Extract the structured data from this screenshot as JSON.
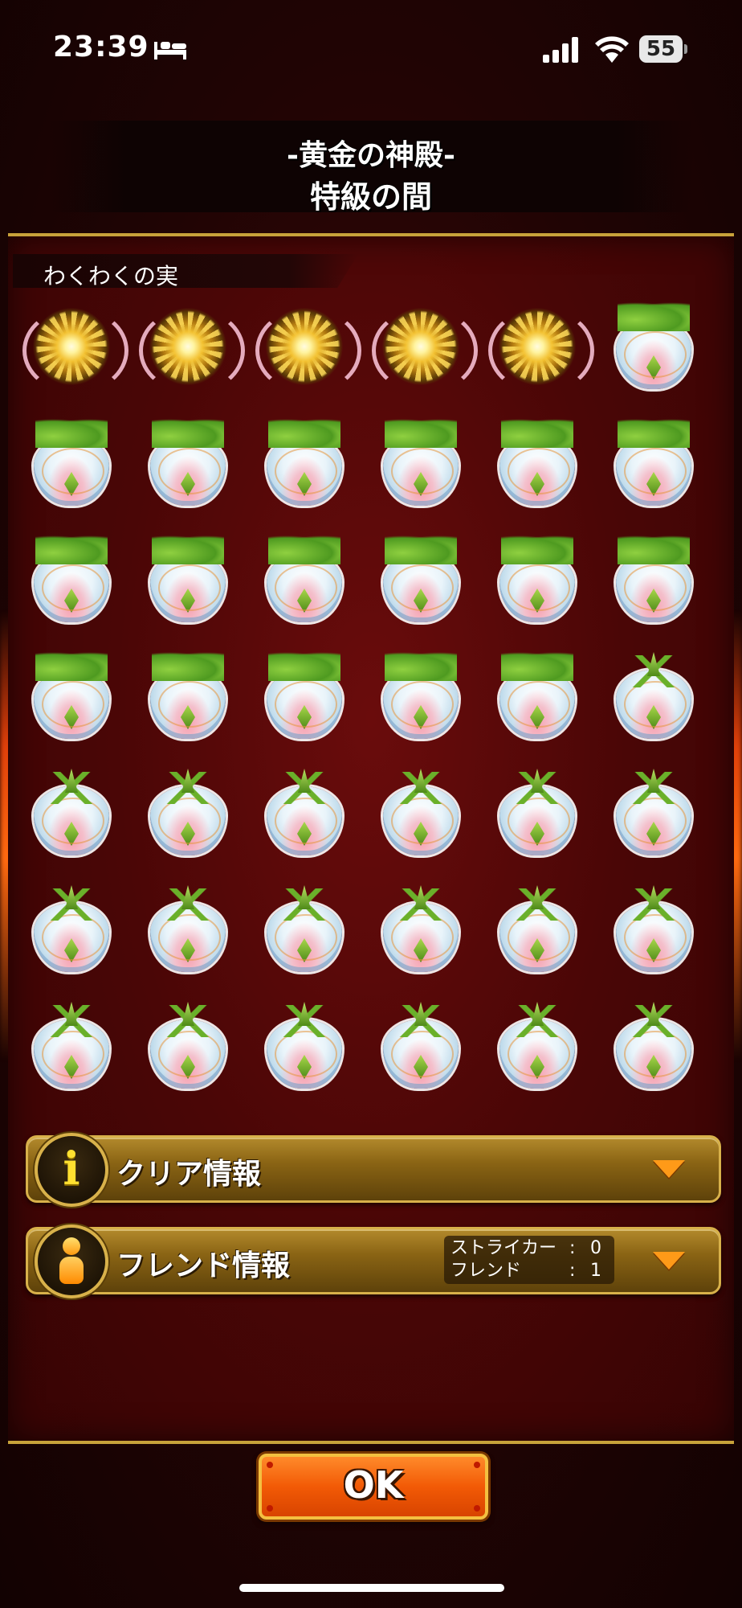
{
  "status_bar": {
    "time": "23:39",
    "battery": "55",
    "icons": [
      "bed-icon",
      "signal-icon",
      "wifi-icon",
      "battery-icon"
    ]
  },
  "header": {
    "title_line1": "-黄金の神殿-",
    "title_line2": "特級の間"
  },
  "rewards": {
    "section_label": "わくわくの実",
    "columns": 6,
    "rows": 7,
    "items": [
      "golden",
      "golden",
      "golden",
      "golden",
      "golden",
      "leaf",
      "leaf",
      "leaf",
      "leaf",
      "leaf",
      "leaf",
      "leaf",
      "leaf",
      "leaf",
      "leaf",
      "leaf",
      "leaf",
      "leaf",
      "leaf",
      "leaf",
      "leaf",
      "leaf",
      "leaf",
      "plain",
      "plain",
      "plain",
      "plain",
      "plain",
      "plain",
      "plain",
      "plain",
      "plain",
      "plain",
      "plain",
      "plain",
      "plain",
      "plain",
      "plain",
      "plain",
      "plain",
      "plain",
      "plain"
    ]
  },
  "clear_info": {
    "label": "クリア情報",
    "icon": "info-icon"
  },
  "friend_info": {
    "label": "フレンド情報",
    "icon": "friend-icon",
    "striker_label": "ストライカー",
    "striker_value": "0",
    "friend_label": "フレンド",
    "friend_value": "1",
    "colon": ":"
  },
  "ok_button": {
    "label": "OK"
  },
  "colors": {
    "accent_gold": "#d8b14a",
    "panel_red": "#4a0606",
    "ok_orange": "#f25a06"
  }
}
